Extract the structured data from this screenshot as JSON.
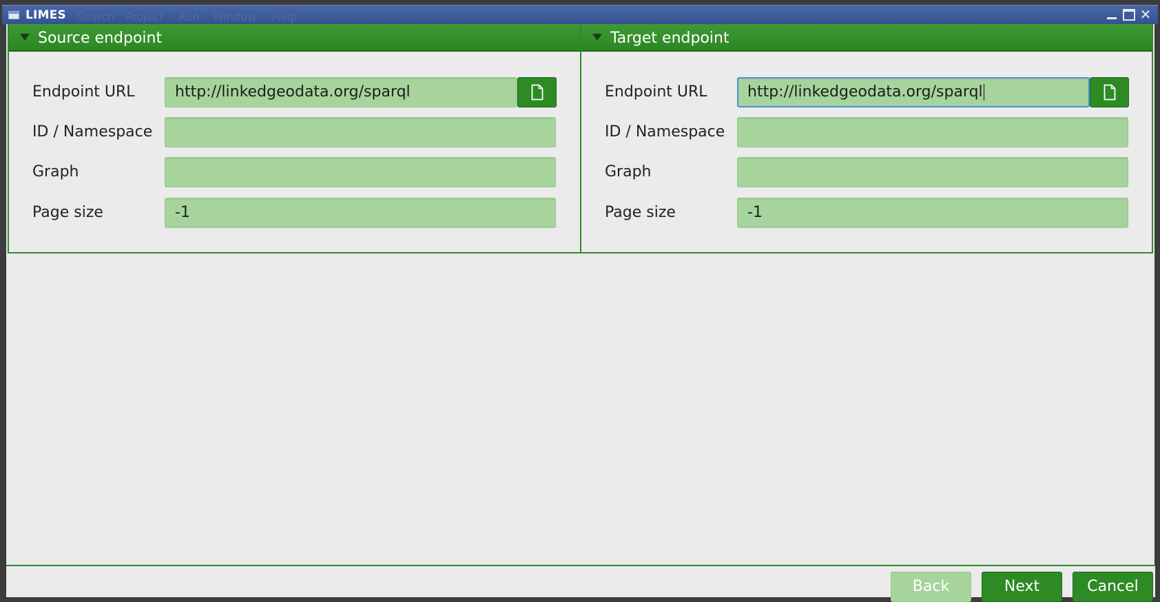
{
  "window": {
    "title": "LIMES",
    "menu": [
      "Search",
      "Project",
      "Run",
      "Window",
      "Help"
    ]
  },
  "source": {
    "header": "Source endpoint",
    "endpoint_url_label": "Endpoint URL",
    "endpoint_url_value": "http://linkedgeodata.org/sparql",
    "id_namespace_label": "ID / Namespace",
    "id_namespace_value": "",
    "graph_label": "Graph",
    "graph_value": "",
    "page_size_label": "Page size",
    "page_size_value": "-1"
  },
  "target": {
    "header": "Target endpoint",
    "endpoint_url_label": "Endpoint URL",
    "endpoint_url_value": "http://linkedgeodata.org/sparql",
    "id_namespace_label": "ID / Namespace",
    "id_namespace_value": "",
    "graph_label": "Graph",
    "graph_value": "",
    "page_size_label": "Page size",
    "page_size_value": "-1"
  },
  "footer": {
    "back_label": "Back",
    "next_label": "Next",
    "cancel_label": "Cancel",
    "back_enabled": false
  },
  "icons": {
    "collapse": "triangle-down-icon",
    "file_picker": "document-icon",
    "app": "window-icon"
  },
  "colors": {
    "accent_green": "#2d8a24",
    "field_green": "#a6d49c",
    "titlebar_blue": "#3b579a",
    "focus_blue": "#4e8fd6"
  }
}
